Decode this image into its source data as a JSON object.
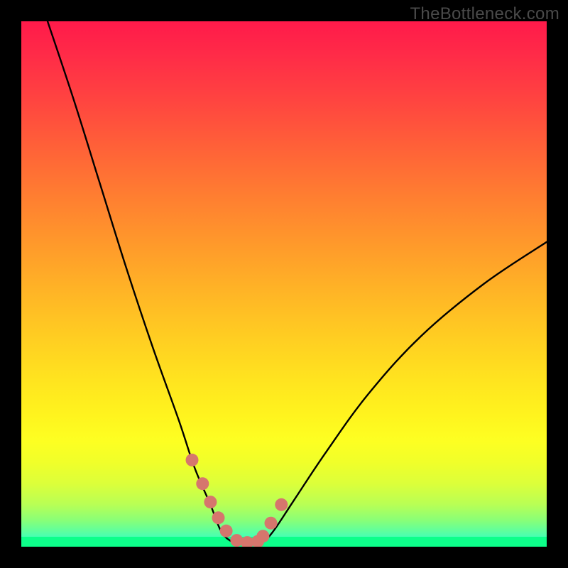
{
  "watermark": "TheBottleneck.com",
  "colors": {
    "background": "#000000",
    "curve": "#000000",
    "markers": "#d6766d",
    "gradient_top": "#ff1a4a",
    "gradient_bottom": "#0effe8",
    "green_band": "#0dff8a",
    "watermark_text": "#4a4a4a"
  },
  "chart_data": {
    "type": "line",
    "title": "",
    "xlabel": "",
    "ylabel": "",
    "xlim": [
      0,
      100
    ],
    "ylim": [
      0,
      100
    ],
    "grid": false,
    "legend": false,
    "description": "Bottleneck percentage curve. Vertical axis is bottleneck severity (0 at bottom/green = no bottleneck, 100 at top/red = severe). Horizontal axis is a component-ratio parameter. Curve reaches near-zero around x≈38–45 (balanced), rising steeply toward both extremes.",
    "series": [
      {
        "name": "bottleneck_curve",
        "x": [
          5,
          10,
          15,
          20,
          25,
          30,
          33,
          36,
          38,
          40,
          42,
          44,
          46,
          48,
          52,
          58,
          66,
          76,
          88,
          100
        ],
        "values": [
          100,
          85,
          69,
          53,
          38,
          24,
          15,
          8,
          3,
          1,
          0.5,
          0.5,
          1,
          3,
          9,
          18,
          29,
          40,
          50,
          58
        ]
      }
    ],
    "markers": {
      "name": "highlighted_points",
      "x": [
        32.5,
        34.5,
        36,
        37.5,
        39,
        41,
        43,
        45,
        46,
        47.5,
        49.5
      ],
      "values": [
        16.5,
        12,
        8.5,
        5.5,
        3,
        1.2,
        0.8,
        1,
        2,
        4.5,
        8
      ]
    }
  }
}
